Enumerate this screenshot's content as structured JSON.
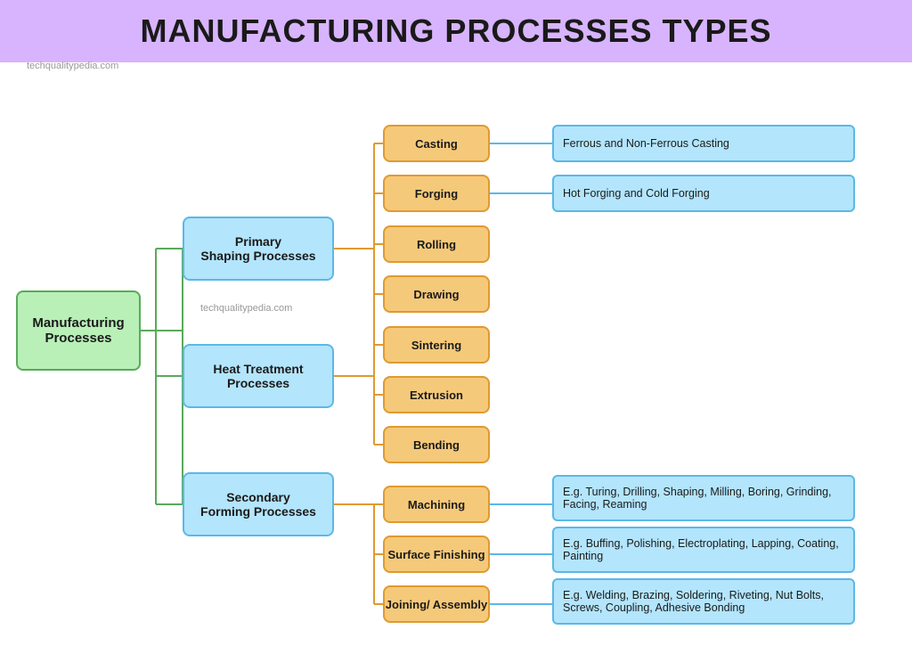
{
  "title": "MANUFACTURING PROCESSES TYPES",
  "watermark1": "techqualitypedia.com",
  "watermark2": "techqualitypedia.com",
  "boxes": {
    "mfg": "Manufacturing\nProcesses",
    "primary": "Primary\nShaping Processes",
    "heat": "Heat Treatment\nProcesses",
    "secondary": "Secondary\nForming Processes"
  },
  "processes": {
    "casting": "Casting",
    "forging": "Forging",
    "rolling": "Rolling",
    "drawing": "Drawing",
    "sintering": "Sintering",
    "extrusion": "Extrusion",
    "bending": "Bending",
    "machining": "Machining",
    "surface": "Surface Finishing",
    "joining": "Joining/ Assembly"
  },
  "details": {
    "ferrous": "Ferrous and Non-Ferrous Casting",
    "forging": "Hot Forging and Cold Forging",
    "machining": "E.g. Turing, Drilling, Shaping, Milling, Boring, Grinding, Facing, Reaming",
    "surface": "E.g. Buffing, Polishing, Electroplating, Lapping, Coating, Painting",
    "joining": "E.g. Welding, Brazing, Soldering, Riveting, Nut Bolts,  Screws,  Coupling, Adhesive Bonding"
  }
}
